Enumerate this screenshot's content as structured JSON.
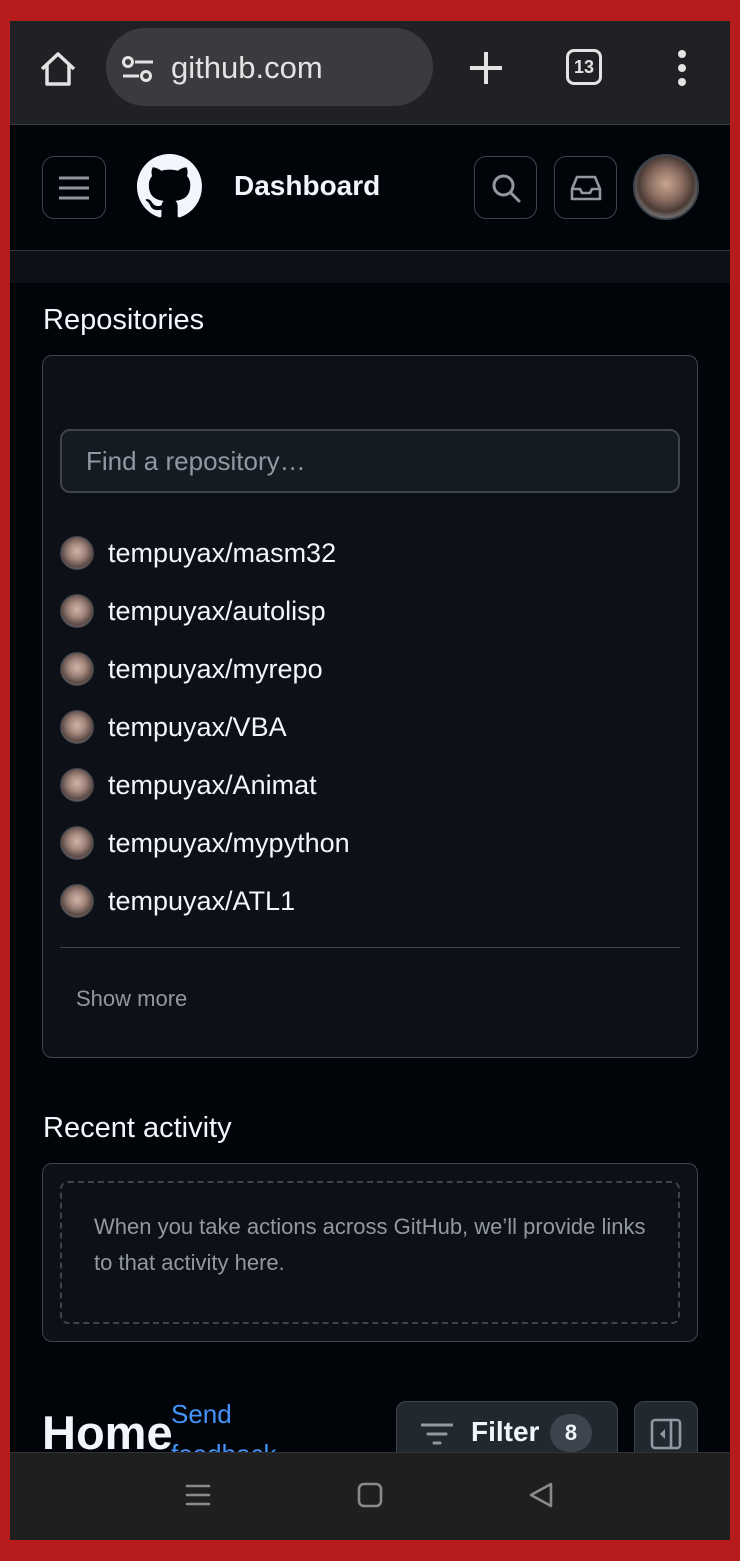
{
  "browser": {
    "url": "github.com",
    "tab_count": "13",
    "icons": [
      "home-icon",
      "site-settings-icon",
      "new-tab-icon",
      "tab-switcher-icon",
      "more-menu-icon"
    ]
  },
  "header": {
    "title": "Dashboard",
    "icons": [
      "hamburger-icon",
      "github-logo",
      "search-icon",
      "inbox-icon",
      "avatar"
    ]
  },
  "repositories": {
    "title": "Repositories",
    "search_placeholder": "Find a repository…",
    "items": [
      {
        "name": "tempuyax/masm32"
      },
      {
        "name": "tempuyax/autolisp"
      },
      {
        "name": "tempuyax/myrepo"
      },
      {
        "name": "tempuyax/VBA"
      },
      {
        "name": "tempuyax/Animat"
      },
      {
        "name": "tempuyax/mypython"
      },
      {
        "name": "tempuyax/ATL1"
      }
    ],
    "show_more": "Show more"
  },
  "recent_activity": {
    "title": "Recent activity",
    "empty_text": "When you take actions across GitHub, we’ll provide links to that activity here."
  },
  "home": {
    "title": "Home",
    "send_feedback": "Send feedback",
    "filter_label": "Filter",
    "filter_count": "8"
  },
  "colors": {
    "background": "#010409",
    "card": "#0d1117",
    "border": "#3d444d",
    "link": "#4493f8",
    "frame": "#b71c1c"
  }
}
